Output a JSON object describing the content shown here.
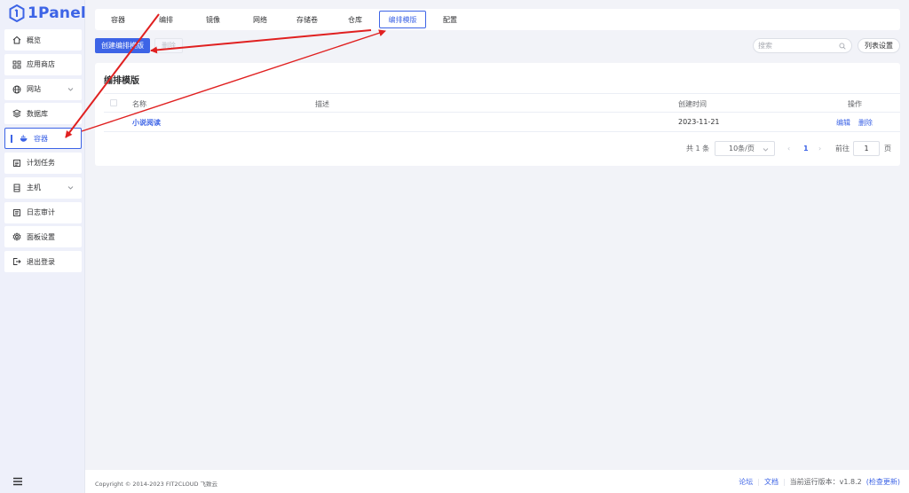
{
  "app": {
    "logo_text": "1Panel"
  },
  "sidebar": {
    "items": [
      {
        "label": "概览",
        "icon": "home-icon"
      },
      {
        "label": "应用商店",
        "icon": "apps-grid-icon"
      },
      {
        "label": "网站",
        "icon": "globe-icon",
        "expandable": true
      },
      {
        "label": "数据库",
        "icon": "database-layers-icon"
      },
      {
        "label": "容器",
        "icon": "docker-icon",
        "active": true
      },
      {
        "label": "计划任务",
        "icon": "calendar-icon"
      },
      {
        "label": "主机",
        "icon": "server-icon",
        "expandable": true
      },
      {
        "label": "日志审计",
        "icon": "log-icon"
      },
      {
        "label": "面板设置",
        "icon": "gear-icon"
      },
      {
        "label": "退出登录",
        "icon": "logout-icon"
      }
    ]
  },
  "tabs": [
    {
      "label": "容器"
    },
    {
      "label": "编排"
    },
    {
      "label": "镜像"
    },
    {
      "label": "网络"
    },
    {
      "label": "存储卷"
    },
    {
      "label": "仓库"
    },
    {
      "label": "编排模版",
      "active": true
    },
    {
      "label": "配置"
    }
  ],
  "toolbar": {
    "create_label": "创建编排模版",
    "delete_label": "删除",
    "search_placeholder": "搜索",
    "list_settings_label": "列表设置"
  },
  "card": {
    "title": "编排模版",
    "columns": [
      "名称",
      "描述",
      "创建时间",
      "操作"
    ],
    "rows": [
      {
        "name": "小说阅读",
        "description": "",
        "created": "2023-11-21",
        "actions": [
          "编辑",
          "删除"
        ]
      }
    ],
    "pagination": {
      "total_text": "共 1 条",
      "page_size": "10条/页",
      "current_page": "1",
      "goto_prefix": "前往",
      "goto_value": "1",
      "goto_suffix": "页"
    }
  },
  "footer": {
    "copyright": "Copyright © 2014-2023 FIT2CLOUD 飞致云",
    "forum": "论坛",
    "docs": "文档",
    "version_label": "当前运行版本：v1.8.2",
    "check_update": "(检查更新)"
  },
  "colors": {
    "accent": "#3d64e6",
    "annotation": "#e02020"
  }
}
